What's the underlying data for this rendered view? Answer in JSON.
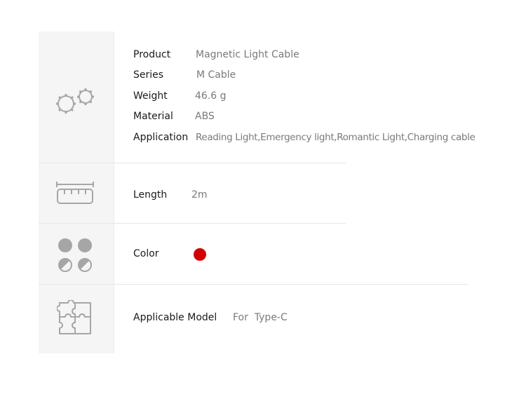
{
  "section1": {
    "icon": "gears-icon",
    "rows": [
      {
        "label": "Product",
        "value": "Magnetic Light Cable"
      },
      {
        "label": "Series",
        "value": "M Cable"
      },
      {
        "label": "Weight",
        "value": "46.6 g"
      },
      {
        "label": "Material",
        "value": "ABS"
      },
      {
        "label": "Application",
        "value": "Reading Light,Emergency light,Romantic Light,Charging cable"
      }
    ]
  },
  "section2": {
    "icon": "ruler-icon",
    "label": "Length",
    "value": "2m"
  },
  "section3": {
    "icon": "color-palette-icon",
    "label": "Color",
    "swatch_color": "#d40000"
  },
  "section4": {
    "icon": "puzzle-icon",
    "label": "Applicable Model",
    "value": "For  Type-C"
  },
  "colors": {
    "icon_gray": "#a6a6a6",
    "icon_column_bg": "#f5f5f5"
  }
}
